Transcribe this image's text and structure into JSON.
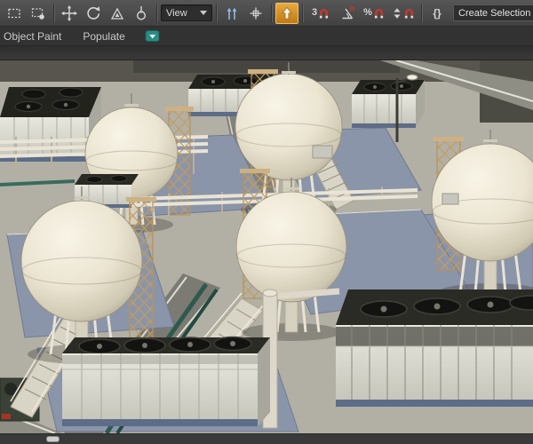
{
  "toolbar": {
    "view_value": "View",
    "snap_3d_label": "3",
    "percent_label": "%",
    "braces_label": "{}",
    "selection_set_value": "Create Selection Set",
    "icons": [
      "rectangular-selection-region-icon",
      "paint-selection-region-icon",
      "select-and-move-icon",
      "select-and-rotate-icon",
      "select-and-scale-icon",
      "select-and-place-icon",
      "reference-coordinate-dropdown",
      "use-pivot-center-icon",
      "select-and-manipulate-icon",
      "keyboard-override-toggle-icon",
      "snap-toggle-3d-icon",
      "angle-snap-icon",
      "percent-snap-icon",
      "spinner-snap-icon",
      "named-selection-sets-icon",
      "selection-set-combobox"
    ]
  },
  "ribbon": {
    "tabs": [
      {
        "label": "Object Paint"
      },
      {
        "label": "Populate"
      }
    ]
  },
  "viewport": {
    "scene": "industrial-plant-3d",
    "objects": [
      "spherical-storage-tanks",
      "cooling-tower-banks",
      "pipe-racks",
      "scaffold-towers",
      "stair-ramps",
      "roads",
      "street-lamp"
    ]
  },
  "colors": {
    "toolbar_bg": "#4a4a4a",
    "ribbon_bg": "#323232",
    "highlight_orange": "#cf8a21",
    "tank_cream": "#ebe5d2",
    "pad_blue": "#8b95a9",
    "ground": "#b2b0a5"
  }
}
